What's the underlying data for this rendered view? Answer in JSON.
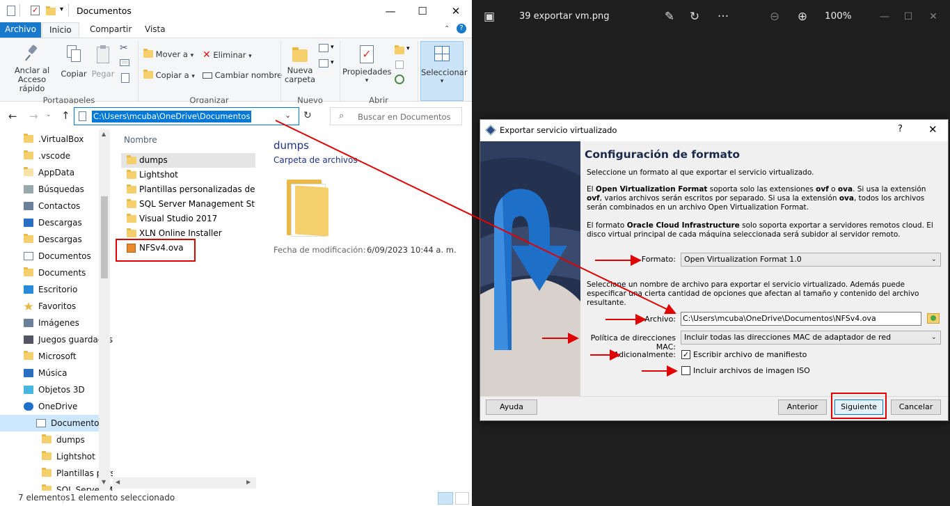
{
  "explorer": {
    "title": "Documentos",
    "tabs": [
      "Archivo",
      "Inicio",
      "Compartir",
      "Vista"
    ],
    "ribbon": {
      "pin_label": "Anclar al Acceso rápido",
      "copy_label": "Copiar",
      "paste_label": "Pegar",
      "move_label": "Mover a",
      "copy_to_label": "Copiar a",
      "delete_label": "Eliminar",
      "rename_label": "Cambiar nombre",
      "new_folder_label": "Nueva carpeta",
      "properties_label": "Propiedades",
      "select_label": "Seleccionar",
      "groups": [
        "Portapapeles",
        "Organizar",
        "Nuevo",
        "Abrir"
      ]
    },
    "address": "C:\\Users\\mcuba\\OneDrive\\Documentos",
    "search_placeholder": "Buscar en Documentos",
    "nav_items": [
      ".VirtualBox",
      ".vscode",
      "AppData",
      "Búsquedas",
      "Contactos",
      "Descargas",
      "Descargas",
      "Documentos",
      "Documents",
      "Escritorio",
      "Favoritos",
      "Imágenes",
      "Juegos guardados",
      "Microsoft",
      "Música",
      "Objetos 3D",
      "OneDrive",
      "Documentos",
      "dumps",
      "Lightshot",
      "Plantillas pers",
      "SQL Server M"
    ],
    "column_header": "Nombre",
    "files": [
      "dumps",
      "Lightshot",
      "Plantillas personalizadas de Office",
      "SQL Server Management Studio",
      "Visual Studio 2017",
      "XLN Online Installer",
      "NFSv4.ova"
    ],
    "preview": {
      "name": "dumps",
      "type": "Carpeta de archivos",
      "date_label": "Fecha de modificación:",
      "date_value": "6/09/2023 10:44 a. m."
    },
    "status": {
      "count": "7 elementos",
      "selected": "1 elemento seleccionado"
    }
  },
  "photos": {
    "filename": "39 exportar vm.png",
    "zoom": "100%"
  },
  "dialog": {
    "title": "Exportar servicio virtualizado",
    "help_glyph": "?",
    "heading": "Configuración de formato",
    "intro": "Seleccione un formato al que exportar el servicio virtualizado.",
    "ovf_p1": "El ",
    "ovf_bold": "Open Virtualization Format",
    "ovf_p2": " soporta solo las extensiones ",
    "ovf_ext1": "ovf",
    "ovf_p3": " o ",
    "ovf_ext2": "ova",
    "ovf_p4": ". Si usa la extensión ",
    "ovf_ext3": "ovf",
    "ovf_p5": ", varios archivos serán escritos por separado. Si usa la extensión ",
    "ovf_ext4": "ova",
    "ovf_p6": ", todos los archivos serán combinados en un archivo Open Virtualization Format.",
    "oci_p1": "El formato ",
    "oci_bold": "Oracle Cloud Infrastructure",
    "oci_p2": " solo soporta exportar a servidores remotos cloud. El disco virtual principal de cada máquina seleccionada será subidor al servidor remoto.",
    "format_label": "Formato:",
    "format_value": "Open Virtualization Format 1.0",
    "file_intro": "Seleccione un nombre de archivo para exportar el servicio virtualizado. Además puede especificar una cierta cantidad de opciones que afectan al tamaño y contenido del archivo resultante.",
    "file_label": "Archivo:",
    "file_value": "C:\\Users\\mcuba\\OneDrive\\Documentos\\NFSv4.ova",
    "mac_label": "Política de direcciones MAC:",
    "mac_value": "Incluir todas las direcciones MAC de adaptador de red",
    "extra_label": "Adicionalmente:",
    "manifest_label": "Escribir archivo de manifiesto",
    "manifest_checked": true,
    "iso_label": "Incluir archivos de imagen ISO",
    "iso_checked": false,
    "help_button": "Ayuda",
    "back_button": "Anterior",
    "next_button": "Siguiente",
    "cancel_button": "Cancelar"
  },
  "colors": {
    "annotation_red": "#e00000",
    "archivo_tab": "#1979ca",
    "address_highlight": "#0078d7",
    "dialog_art": "#1f2c46"
  }
}
